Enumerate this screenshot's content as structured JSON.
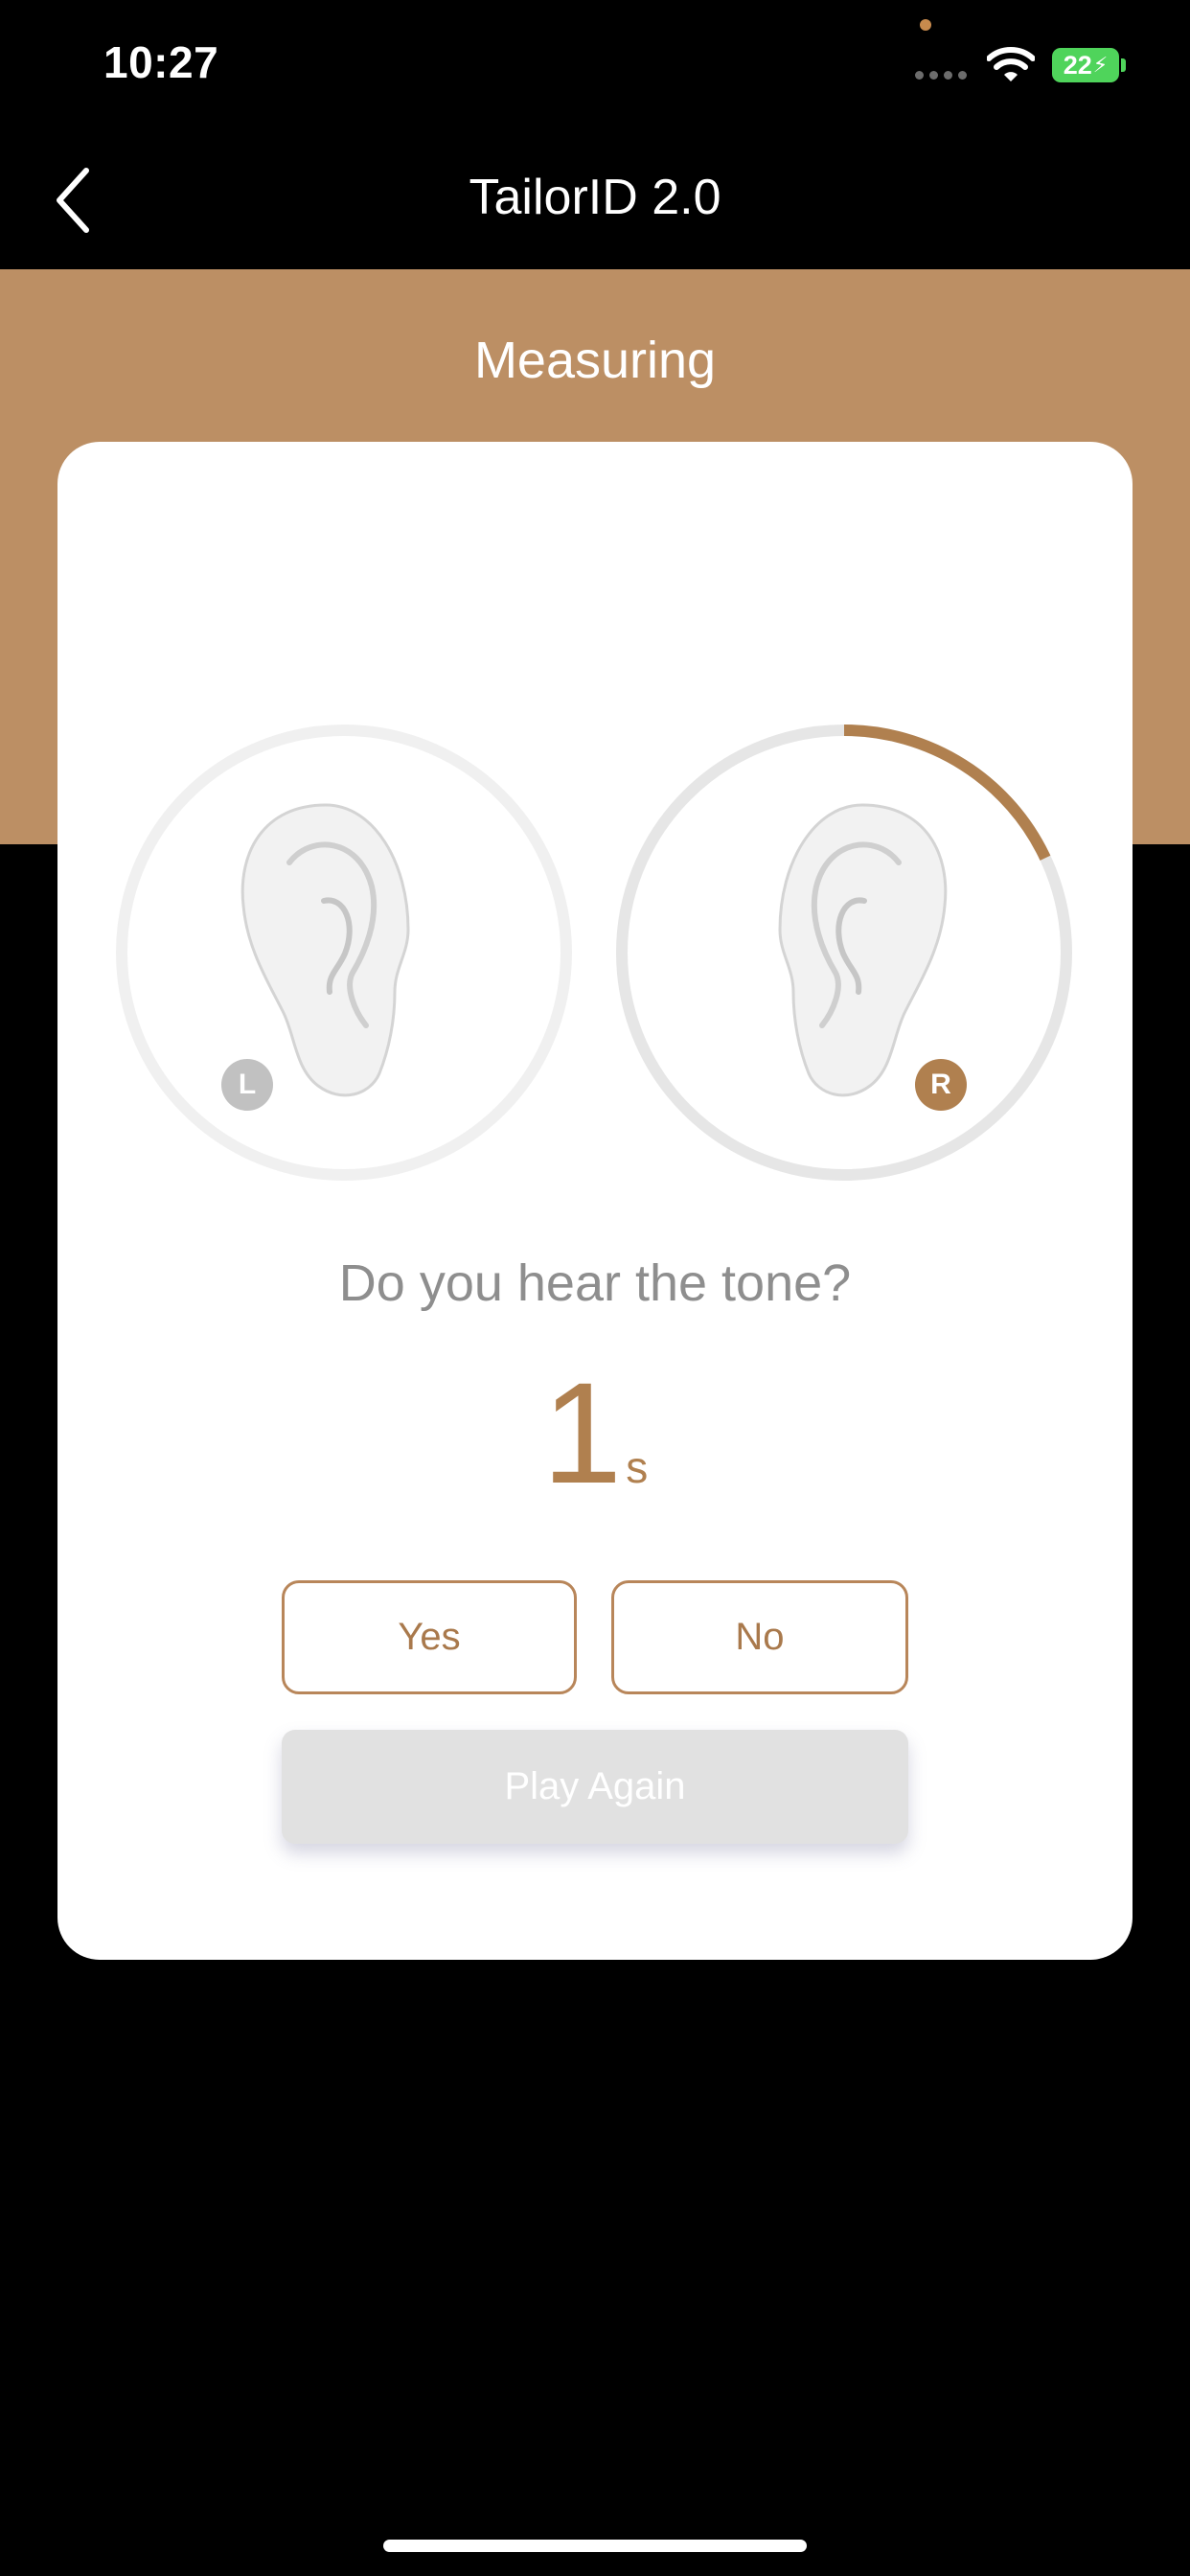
{
  "status_bar": {
    "time": "10:27",
    "battery": "22",
    "battery_color": "#4fd45b",
    "icons": [
      "cellular-signal-icon",
      "wifi-icon",
      "battery-charging-icon"
    ]
  },
  "nav": {
    "title": "TailorID 2.0",
    "back_icon": "chevron-left-icon"
  },
  "header": {
    "title": "Measuring",
    "accent_color": "#bc8f64"
  },
  "test": {
    "left_ear_label": "L",
    "right_ear_label": "R",
    "left_progress": 0.0,
    "right_progress": 0.18,
    "active_ear": "R",
    "question": "Do you hear the tone?",
    "countdown_value": "1",
    "countdown_unit": "s",
    "yes_label": "Yes",
    "no_label": "No",
    "play_again_label": "Play Again"
  }
}
